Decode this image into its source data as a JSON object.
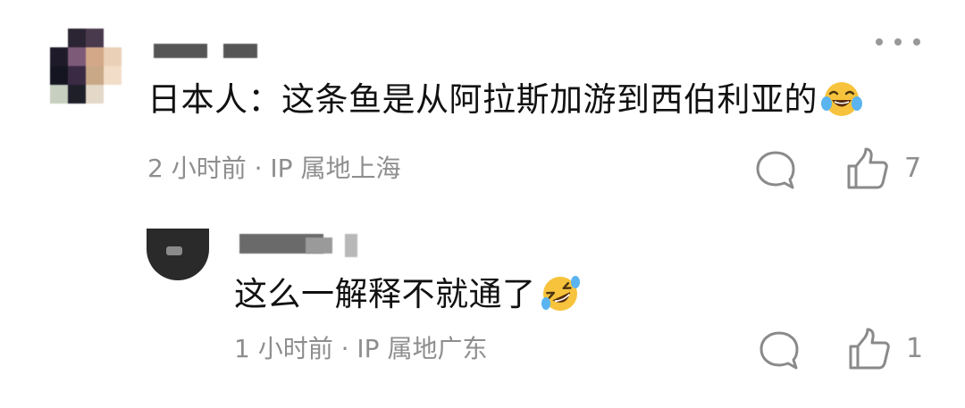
{
  "comment": {
    "text": "日本人：这条鱼是从阿拉斯加游到西伯利亚的",
    "emoji": "laughing-tears",
    "time": "2 小时前",
    "location": "· IP 属地上海",
    "like_count": "7"
  },
  "reply": {
    "text": "这么一解释不就通了",
    "emoji": "rolling-on-floor-laughing",
    "time": "1 小时前",
    "location": "· IP 属地广东",
    "like_count": "1"
  },
  "icons": {
    "more": "more-dots-icon",
    "reply": "comment-bubble-icon",
    "like": "thumbs-up-icon"
  },
  "colors": {
    "text": "#111111",
    "meta": "#8e8e8e",
    "icon": "#8a8a8a"
  }
}
